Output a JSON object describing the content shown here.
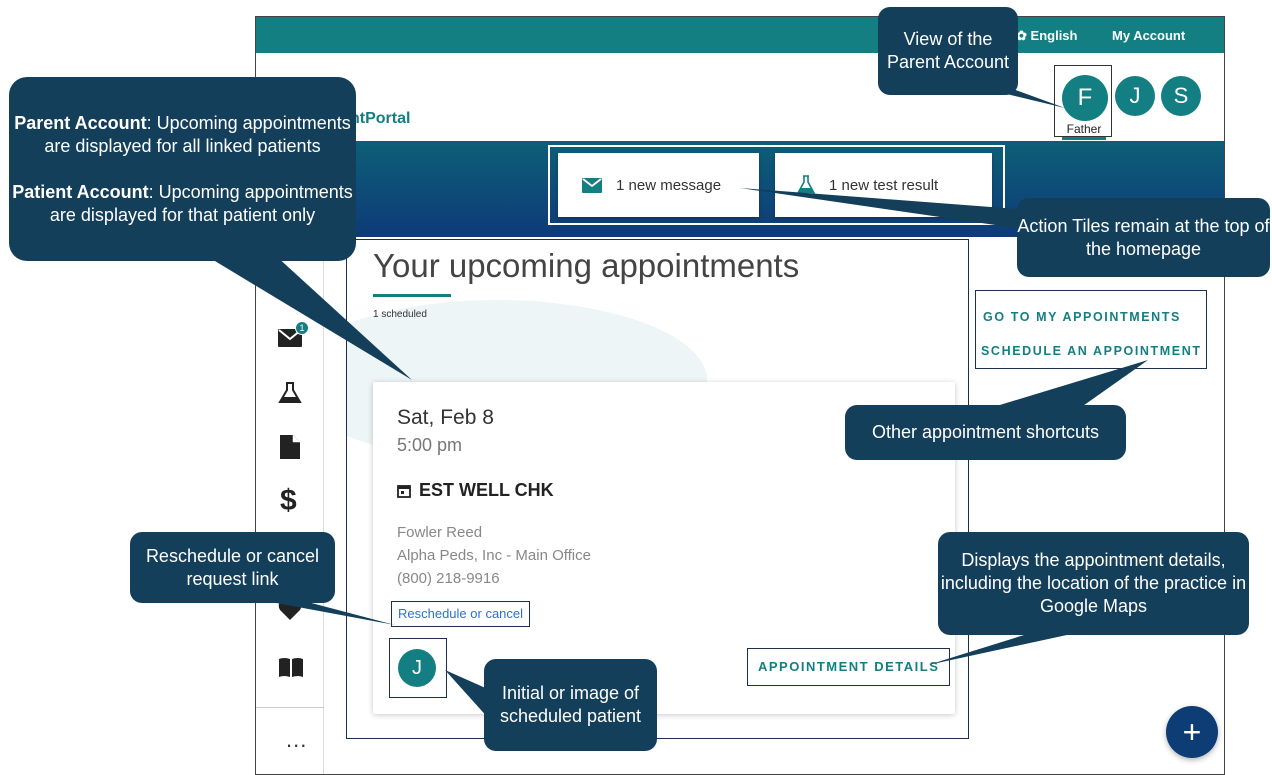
{
  "topbar": {
    "language": "English",
    "account": "My Account"
  },
  "brand": {
    "name": "ntPortal"
  },
  "profiles": [
    {
      "initial": "F",
      "label": "Father"
    },
    {
      "initial": "J"
    },
    {
      "initial": "S"
    }
  ],
  "tiles": [
    {
      "label": "1 new message",
      "icon": "envelope-icon"
    },
    {
      "label": "1 new test result",
      "icon": "flask-icon"
    }
  ],
  "sidebar": {
    "message_badge": "1",
    "items": [
      "envelope-icon",
      "flask-icon",
      "document-icon",
      "dollar-icon",
      "heart-icon",
      "book-icon"
    ],
    "more": "..."
  },
  "appointments": {
    "title": "Your upcoming appointments",
    "count": "1 scheduled",
    "card": {
      "date": "Sat, Feb 8",
      "time": "5:00 pm",
      "visit_type": "EST WELL CHK",
      "provider": "Fowler Reed",
      "location": "Alpha Peds, Inc - Main Office",
      "phone": "(800) 218-9916",
      "reschedule_label": "Reschedule or cancel",
      "patient_initial": "J",
      "details_label": "APPOINTMENT DETAILS"
    }
  },
  "shortcuts": {
    "go_to": "GO TO MY APPOINTMENTS",
    "schedule": "SCHEDULE AN APPOINTMENT"
  },
  "fab": {
    "label": "+"
  },
  "callouts": {
    "parent": {
      "bold1": "Parent Account",
      "text1": ": Upcoming appointments are displayed for all linked patients",
      "bold2": "Patient Account",
      "text2": ": Upcoming appointments are displayed for that patient only"
    },
    "view_parent": "View of the Parent Account",
    "action_tiles": "Action Tiles remain at the top of the homepage",
    "other_shortcuts": "Other appointment shortcuts",
    "details": "Displays the appointment details, including the location of the practice in Google Maps",
    "reschedule": "Reschedule or cancel request link",
    "initial": "Initial or image of scheduled patient"
  },
  "colors": {
    "teal": "#137f83",
    "navy": "#0e3a78",
    "callout": "#143f5a",
    "link": "#2f6fd1"
  }
}
